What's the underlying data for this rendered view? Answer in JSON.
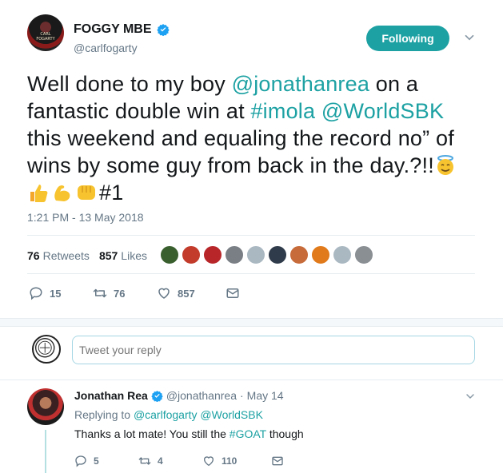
{
  "tweet": {
    "display_name": "FOGGY MBE",
    "handle": "@carlfogarty",
    "follow_label": "Following",
    "avatar_text": "CARL FOGARTY",
    "text_parts": [
      {
        "t": "Well done to my boy ",
        "link": false
      },
      {
        "t": "@jonathanrea",
        "link": true
      },
      {
        "t": " on a fantastic double win at ",
        "link": false
      },
      {
        "t": "#imola",
        "link": true
      },
      {
        "t": " ",
        "link": false
      },
      {
        "t": "@WorldSBK",
        "link": true
      },
      {
        "t": " this weekend and equaling the record no” of wins by some guy from back in the day.?!!",
        "link": false
      }
    ],
    "hashtag_tail": "#1",
    "emojis": [
      "smiling-face-with-halo",
      "thumbs-up",
      "flexed-biceps",
      "oncoming-fist"
    ],
    "timestamp": "1:21 PM - 13 May 2018",
    "retweets_count": "76",
    "retweets_label": "Retweets",
    "likes_count": "857",
    "likes_label": "Likes",
    "actions": {
      "replies": "15",
      "retweets": "76",
      "likes": "857"
    }
  },
  "liker_colors": [
    "#3a5f2f",
    "#c23b2b",
    "#b8262a",
    "#7a7f85",
    "#aab8c2",
    "#2f3b4a",
    "#c76b3a",
    "#e07a1a",
    "#aab8c2",
    "#8a8f94"
  ],
  "reply_box": {
    "placeholder": "Tweet your reply"
  },
  "reply": {
    "name": "Jonathan Rea",
    "handle": "@jonathanrea",
    "separator": "·",
    "date": "May 14",
    "replying_prefix": "Replying to",
    "replying_to_1": "@carlfogarty",
    "replying_to_2": "@WorldSBK",
    "text_before": "Thanks a lot mate! You still the ",
    "text_hashtag": "#GOAT",
    "text_after": " though",
    "actions": {
      "replies": "5",
      "retweets": "4",
      "likes": "110"
    }
  },
  "colors": {
    "accent": "#1da1a3",
    "verified": "#1da1f2",
    "muted": "#657786"
  }
}
